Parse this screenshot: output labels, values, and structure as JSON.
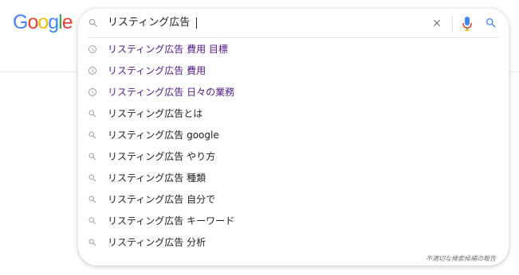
{
  "logo": {
    "letters": [
      {
        "ch": "G",
        "color": "#4285F4"
      },
      {
        "ch": "o",
        "color": "#EA4335"
      },
      {
        "ch": "o",
        "color": "#FBBC05"
      },
      {
        "ch": "g",
        "color": "#4285F4"
      },
      {
        "ch": "l",
        "color": "#34A853"
      },
      {
        "ch": "e",
        "color": "#EA4335"
      }
    ]
  },
  "search": {
    "query": "リスティング広告",
    "icon": "search-icon",
    "clear_icon": "close-icon",
    "voice_icon": "mic-icon",
    "submit_icon": "search-icon"
  },
  "suggestions": [
    {
      "text": "リスティング広告 費用 目標",
      "type": "history",
      "icon": "history-icon"
    },
    {
      "text": "リスティング広告 費用",
      "type": "history",
      "icon": "history-icon"
    },
    {
      "text": "リスティング広告 日々の業務",
      "type": "history",
      "icon": "history-icon"
    },
    {
      "text": "リスティング広告とは",
      "type": "search",
      "icon": "search-icon"
    },
    {
      "text": "リスティング広告 google",
      "type": "search",
      "icon": "search-icon"
    },
    {
      "text": "リスティング広告 やり方",
      "type": "search",
      "icon": "search-icon"
    },
    {
      "text": "リスティング広告 種類",
      "type": "search",
      "icon": "search-icon"
    },
    {
      "text": "リスティング広告 自分で",
      "type": "search",
      "icon": "search-icon"
    },
    {
      "text": "リスティング広告 キーワード",
      "type": "search",
      "icon": "search-icon"
    },
    {
      "text": "リスティング広告 分析",
      "type": "search",
      "icon": "search-icon"
    }
  ],
  "report_link": "不適切な検索候補の報告",
  "colors": {
    "history_text": "#52188c",
    "default_text": "#202124",
    "icon_gray": "#9aa0a6",
    "accent_blue": "#4285F4"
  }
}
